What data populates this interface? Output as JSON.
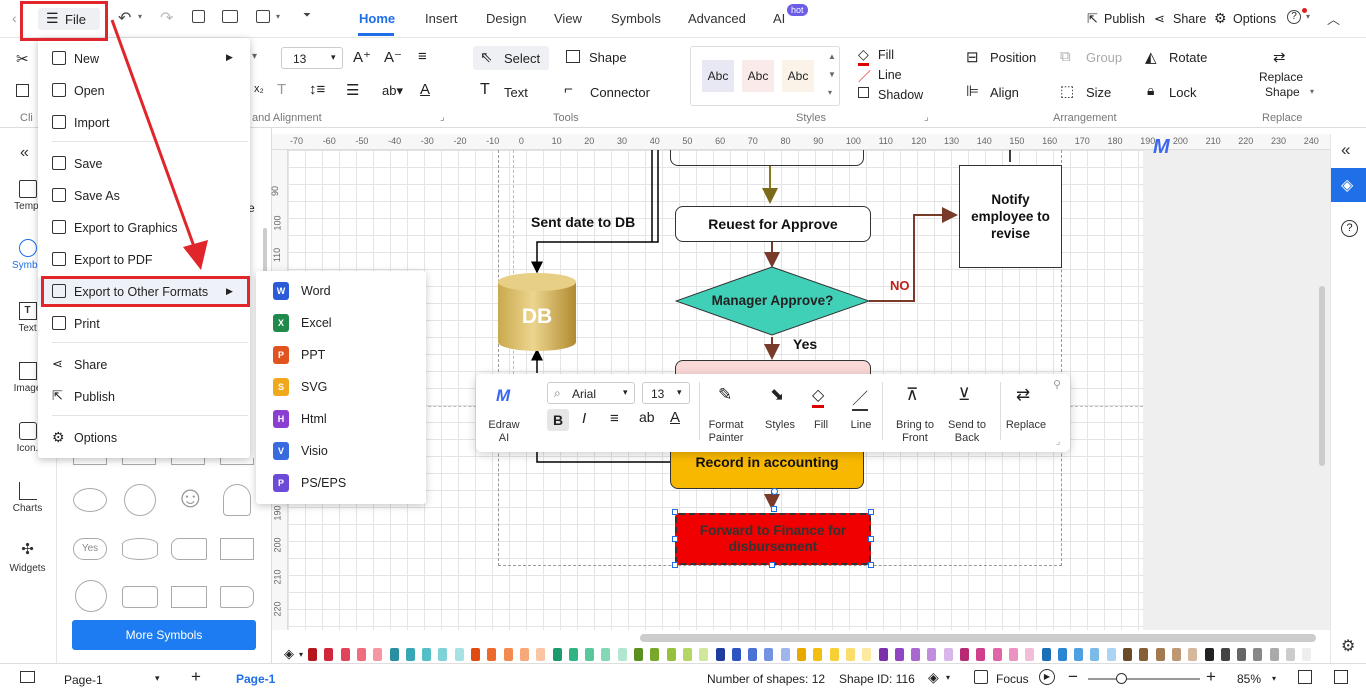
{
  "topbar": {
    "file_label": "File",
    "tabs": [
      "Home",
      "Insert",
      "Design",
      "View",
      "Symbols",
      "Advanced",
      "AI"
    ],
    "ai_badge": "hot",
    "publish": "Publish",
    "share": "Share",
    "options": "Options"
  },
  "ribbon": {
    "font_size": "13",
    "select": "Select",
    "shape": "Shape",
    "text": "Text",
    "connector": "Connector",
    "style_samples": [
      "Abc",
      "Abc",
      "Abc"
    ],
    "fill": "Fill",
    "line": "Line",
    "shadow": "Shadow",
    "position": "Position",
    "group": "Group",
    "rotate": "Rotate",
    "align": "Align",
    "size": "Size",
    "lock": "Lock",
    "replace_shape_1": "Replace",
    "replace_shape_2": "Shape",
    "groups": {
      "clip": "Cli",
      "alignment": "and Alignment",
      "tools": "Tools",
      "styles": "Styles",
      "arrangement": "Arrangement",
      "replace": "Replace"
    }
  },
  "leftrail": {
    "templates": "Templ",
    "symbols": "Symbo",
    "text": "Text",
    "images": "Image",
    "icons": "Icon.",
    "charts": "Charts",
    "widgets": "Widgets"
  },
  "file_menu": {
    "items": [
      "New",
      "Open",
      "Import",
      "Save",
      "Save As",
      "Export to Graphics",
      "Export to PDF",
      "Export to Other Formats",
      "Print",
      "Share",
      "Publish",
      "Options"
    ]
  },
  "export_submenu": {
    "items": [
      "Word",
      "Excel",
      "PPT",
      "SVG",
      "Html",
      "Visio",
      "PS/EPS"
    ]
  },
  "panel": {
    "more_symbols": "More Symbols",
    "yes_shape": "Yes",
    "partial_e": "e"
  },
  "ruler": {
    "top": [
      "-70",
      "-60",
      "-50",
      "-40",
      "-30",
      "-20",
      "-10",
      "0",
      "10",
      "20",
      "30",
      "40",
      "50",
      "60",
      "70",
      "80",
      "90",
      "100",
      "110",
      "120",
      "130",
      "140",
      "150",
      "160",
      "170",
      "180",
      "190",
      "200",
      "210",
      "220",
      "230",
      "240"
    ],
    "left": [
      "90",
      "100",
      "110",
      "190",
      "200",
      "210",
      "220"
    ]
  },
  "flowchart": {
    "sent_date": "Sent date to DB",
    "request": "Reuest for Approve",
    "notify": "Notify employee to revise",
    "db": "DB",
    "decision": "Manager Approve?",
    "no": "NO",
    "yes": "Yes",
    "record": "Record in  accounting",
    "forward": "Forward to Finance for disbursement"
  },
  "floating_toolbar": {
    "edraw_ai": "Edraw AI",
    "font": "Arial",
    "size": "13",
    "format_painter_1": "Format",
    "format_painter_2": "Painter",
    "styles": "Styles",
    "fill": "Fill",
    "line": "Line",
    "bring_front_1": "Bring to",
    "bring_front_2": "Front",
    "send_back_1": "Send to",
    "send_back_2": "Back",
    "replace": "Replace",
    "b": "B",
    "i": "I",
    "ab": "ab"
  },
  "status": {
    "page_select": "Page-1",
    "page_tab": "Page-1",
    "shapes": "Number of shapes: 12",
    "shape_id": "Shape ID: 116",
    "focus": "Focus",
    "zoom": "85%"
  },
  "palette": [
    "#b5161b",
    "#d0273a",
    "#e2455a",
    "#ef6d7c",
    "#f596a0",
    "#2a8fa0",
    "#38a7b5",
    "#55bfc8",
    "#7fd3d8",
    "#a6e2e4",
    "#e04b12",
    "#ec6a2c",
    "#f38a4e",
    "#f7a877",
    "#f9c5a2",
    "#1d9b6e",
    "#2fb584",
    "#58c79c",
    "#84d8b6",
    "#b1e7d0",
    "#5b8f1e",
    "#78a82a",
    "#97c03e",
    "#b5d565",
    "#d1e79a",
    "#1f3d9e",
    "#2c55c2",
    "#4a72d6",
    "#7393e2",
    "#a1b5ed",
    "#e8a800",
    "#f2bf10",
    "#f7d035",
    "#fadd6b",
    "#fde9a0",
    "#7b2fa8",
    "#9245c0",
    "#a868d0",
    "#c08edd",
    "#d8b6ea",
    "#b72a73",
    "#cf3f8c",
    "#e066a7",
    "#ea92c0",
    "#f2bdd8",
    "#1b6fb8",
    "#2a86d3",
    "#4ea0e0",
    "#7cbbe8",
    "#aad4f1",
    "#6b4a2a",
    "#875f37",
    "#a37a4f",
    "#bd9873",
    "#d6b99d",
    "#222222",
    "#444444",
    "#666666",
    "#888888",
    "#aaaaaa",
    "#cccccc",
    "#eeeeee"
  ]
}
